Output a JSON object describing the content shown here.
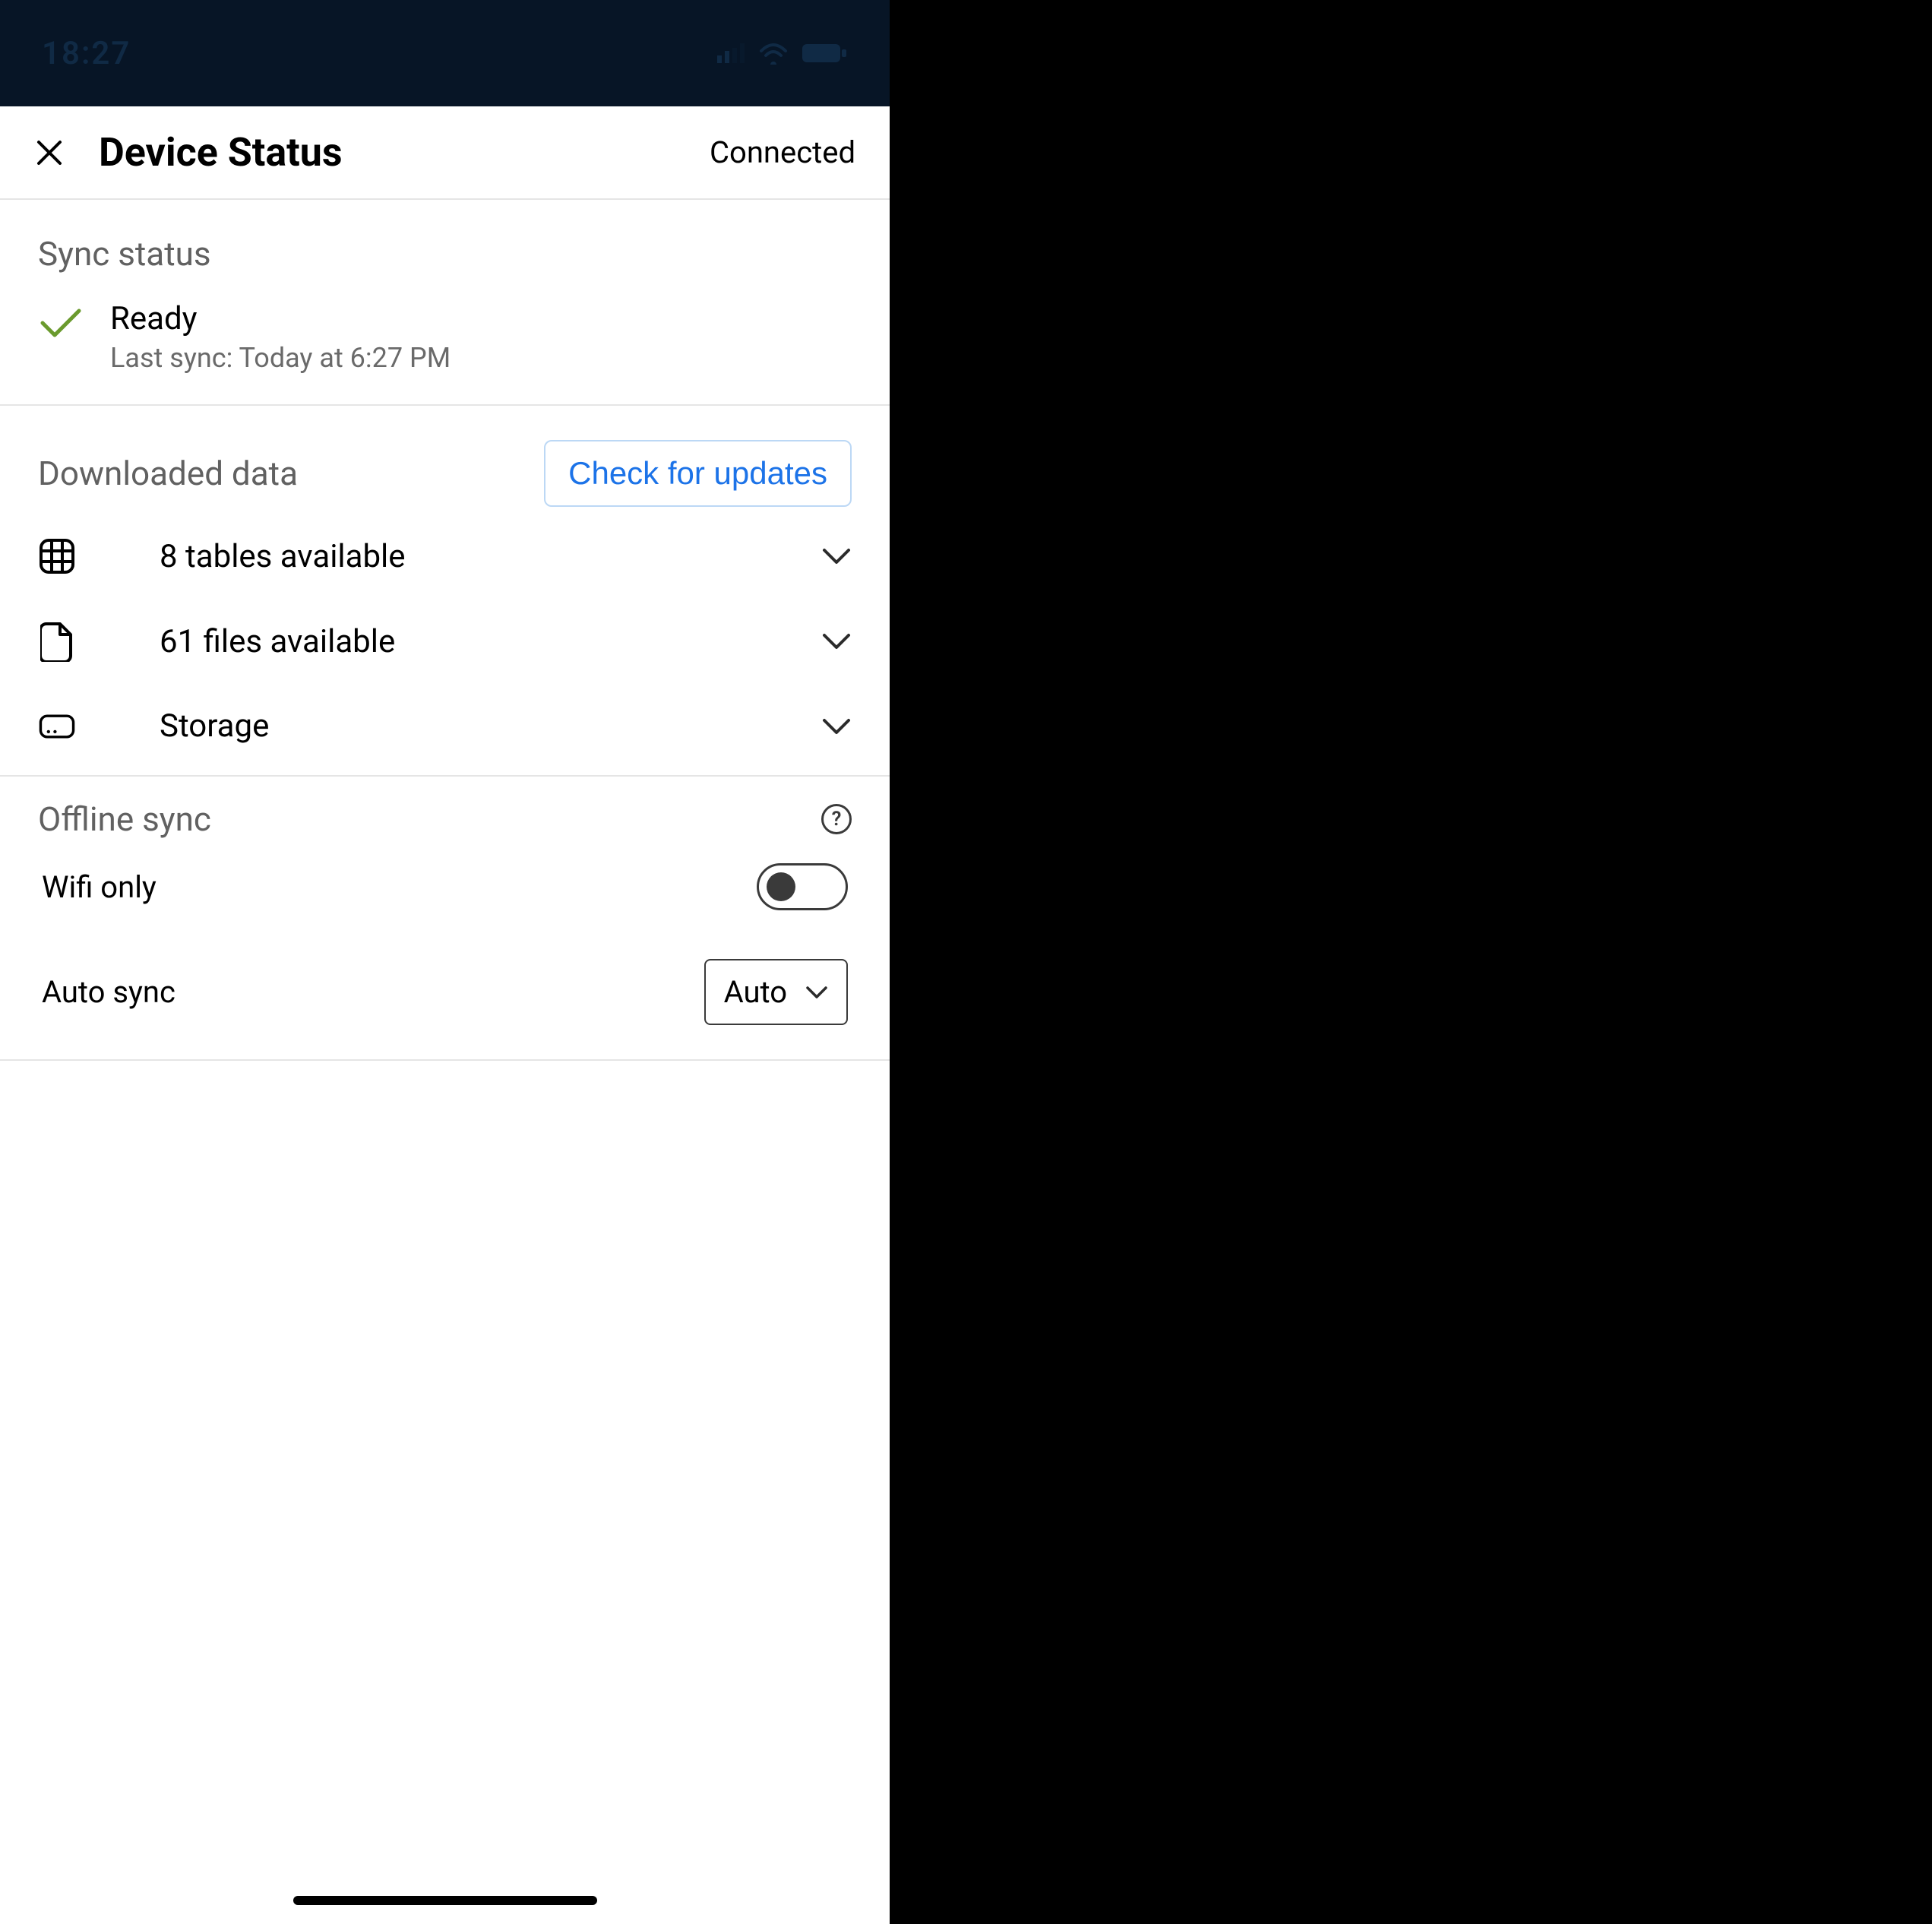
{
  "status_bar": {
    "time": "18:27"
  },
  "nav": {
    "title": "Device Status",
    "connection": "Connected"
  },
  "sync_status": {
    "title": "Sync status",
    "state": "Ready",
    "detail": "Last sync: Today at 6:27 PM"
  },
  "downloaded": {
    "title": "Downloaded data",
    "check_button": "Check for updates",
    "rows": {
      "tables": "8 tables available",
      "files": "61 files available",
      "storage": "Storage"
    }
  },
  "offline": {
    "title": "Offline sync",
    "wifi_only_label": "Wifi only",
    "wifi_only_on": false,
    "auto_sync_label": "Auto sync",
    "auto_sync_value": "Auto"
  }
}
